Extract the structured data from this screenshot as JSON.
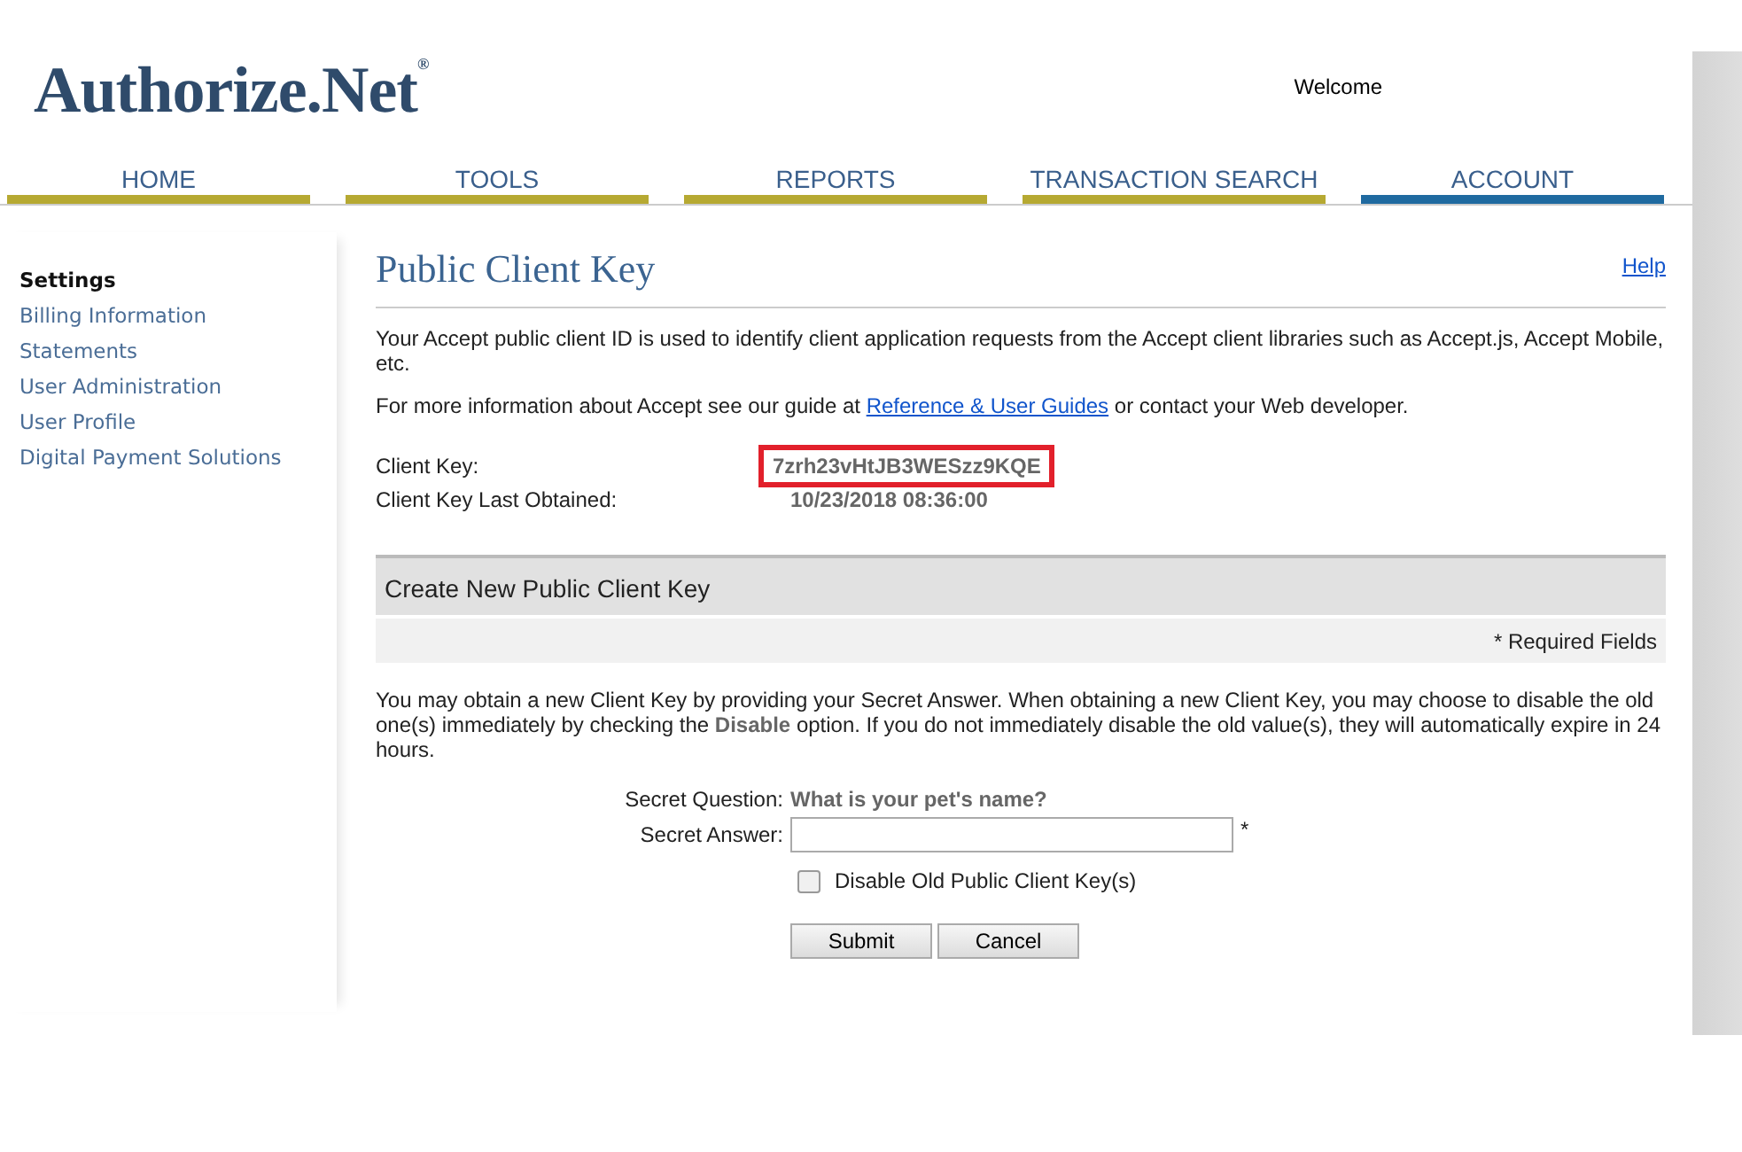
{
  "header": {
    "logo": "Authorize.Net",
    "logo_mark": "®",
    "welcome": "Welcome"
  },
  "nav": [
    {
      "label": "HOME",
      "selected": false
    },
    {
      "label": "TOOLS",
      "selected": false
    },
    {
      "label": "REPORTS",
      "selected": false
    },
    {
      "label": "TRANSACTION SEARCH",
      "selected": false
    },
    {
      "label": "ACCOUNT",
      "selected": true
    }
  ],
  "sidebar": {
    "items": [
      {
        "label": "Settings",
        "selected": true
      },
      {
        "label": "Billing Information",
        "selected": false
      },
      {
        "label": "Statements",
        "selected": false
      },
      {
        "label": "User Administration",
        "selected": false
      },
      {
        "label": "User Profile",
        "selected": false
      },
      {
        "label": "Digital Payment Solutions",
        "selected": false
      }
    ]
  },
  "page": {
    "title": "Public Client Key",
    "help": "Help",
    "intro": "Your Accept public client ID is used to identify client application requests from the Accept client libraries such as Accept.js, Accept Mobile, etc.",
    "info_before": "For more information about Accept see our guide at",
    "info_link": "Reference & User Guides",
    "info_after": "or contact your Web developer.",
    "fields": [
      {
        "label": "Client Key:",
        "value": "7zrh23vHtJB3WESzz9KQE",
        "highlighted": true
      },
      {
        "label": "Client Key Last Obtained:",
        "value": "10/23/2018 08:36:00",
        "highlighted": false
      }
    ]
  },
  "form": {
    "title": "Create New Public Client Key",
    "required_note": "* Required Fields",
    "description": "You may obtain a new Client Key by providing your Secret Answer. When obtaining a new Client Key, you may choose to disable the old one(s) immediately by checking the **Disable** option. If you do not immediately disable the old value(s), they will automatically expire in 24 hours.",
    "question_label": "Secret Question:",
    "question": "What is your pet's name?",
    "answer_label": "Secret Answer:",
    "required_mark": "*",
    "disable_old": {
      "label": "Disable Old Public Client Key(s)",
      "checked": false
    },
    "buttons": [
      "Submit",
      "Cancel"
    ]
  }
}
